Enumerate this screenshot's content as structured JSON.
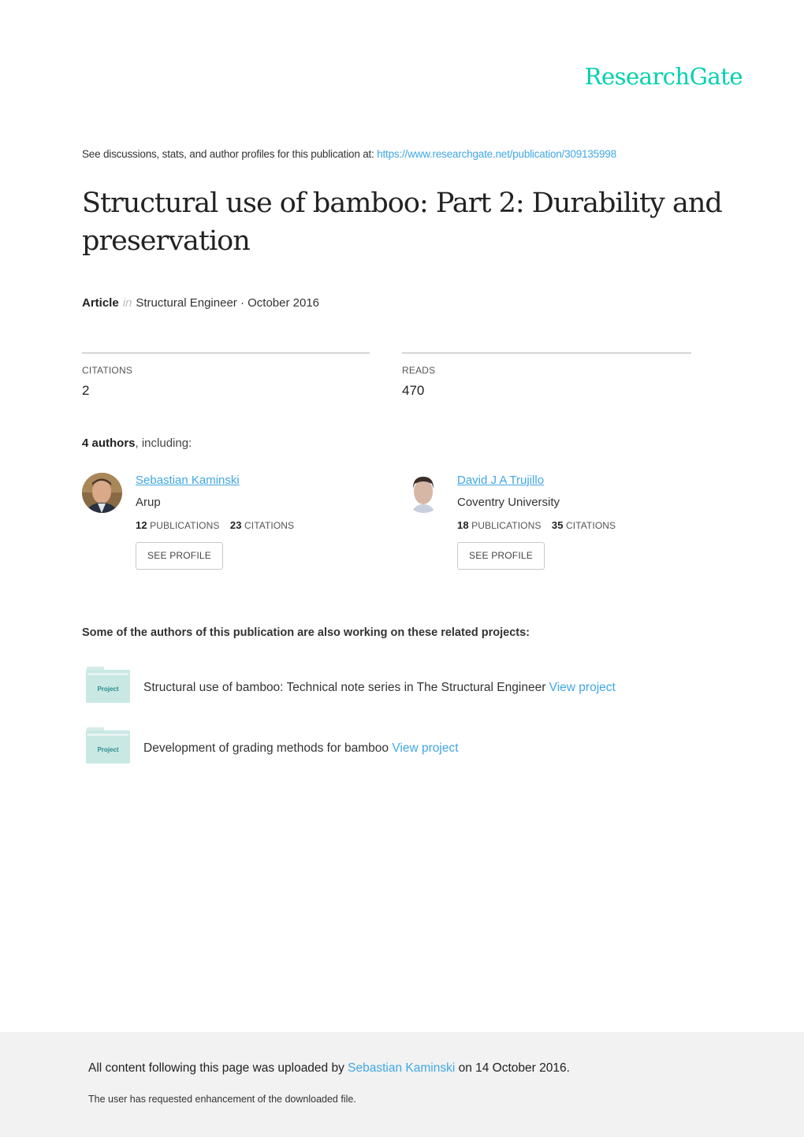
{
  "brand": {
    "logo_text": "ResearchGate",
    "accent_color": "#00d0af",
    "link_color": "#40a7e3"
  },
  "header": {
    "discussion_text": "See discussions, stats, and author profiles for this publication at: ",
    "publication_url": "https://www.researchgate.net/publication/309135998"
  },
  "publication": {
    "title": "Structural use of bamboo: Part 2: Durability and preservation",
    "type": "Article",
    "in_label": "in",
    "venue_date": "Structural Engineer · October 2016"
  },
  "stats": {
    "citations": {
      "label": "CITATIONS",
      "value": "2"
    },
    "reads": {
      "label": "READS",
      "value": "470"
    }
  },
  "authors_section": {
    "count_text": "4 authors",
    "suffix": ", including:",
    "authors": [
      {
        "name": "Sebastian Kaminski",
        "institution": "Arup",
        "publications": "12",
        "publications_label": "PUBLICATIONS",
        "citations": "23",
        "citations_label": "CITATIONS",
        "button_label": "SEE PROFILE"
      },
      {
        "name": "David J A Trujillo",
        "institution": "Coventry University",
        "publications": "18",
        "publications_label": "PUBLICATIONS",
        "citations": "35",
        "citations_label": "CITATIONS",
        "button_label": "SEE PROFILE"
      }
    ]
  },
  "related_projects": {
    "heading": "Some of the authors of this publication are also working on these related projects:",
    "icon_label": "Project",
    "items": [
      {
        "title": "Structural use of bamboo: Technical note series in The Structural Engineer",
        "link_label": "View project"
      },
      {
        "title": "Development of grading methods for bamboo",
        "link_label": "View project"
      }
    ]
  },
  "footer": {
    "uploaded_prefix": "All content following this page was uploaded by ",
    "uploader": "Sebastian Kaminski",
    "uploaded_suffix": " on 14 October 2016.",
    "request_note": "The user has requested enhancement of the downloaded file."
  }
}
